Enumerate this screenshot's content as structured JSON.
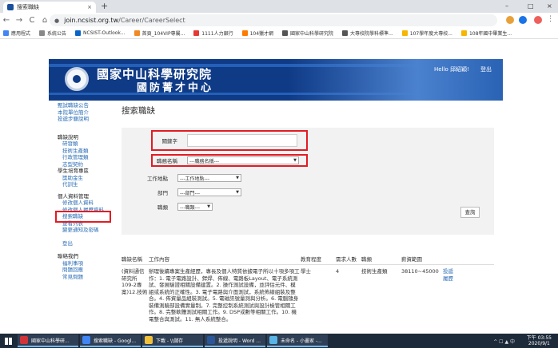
{
  "browser": {
    "tab_title": "搜索職缺",
    "tab_close": "×",
    "new_tab": "+",
    "url_host": "join.ncsist.org.tw",
    "url_path": "/Career/CareerSelect",
    "nav_back": "←",
    "nav_forward": "→",
    "nav_reload": "C",
    "nav_home": "⌂"
  },
  "window_controls": {
    "minimize": "–",
    "maximize": "□",
    "close": "×"
  },
  "bookmarks": [
    {
      "label": "應用程式",
      "color": "#4285f4"
    },
    {
      "label": "系統公告",
      "color": "#888888"
    },
    {
      "label": "NCSIST-Outlook...",
      "color": "#0a64c8"
    },
    {
      "label": "首頁_104VIP專屬...",
      "color": "#f08a24"
    },
    {
      "label": "1111人力銀行",
      "color": "#e53935"
    },
    {
      "label": "104獵才網",
      "color": "#ff7a00"
    },
    {
      "label": "國家中山科學研究院",
      "color": "#555555"
    },
    {
      "label": "大專校院學科標準...",
      "color": "#555555"
    },
    {
      "label": "107學年度大專校...",
      "color": "#f6b500"
    },
    {
      "label": "108年國中畢業生...",
      "color": "#f6b500"
    }
  ],
  "banner": {
    "title": "國家中山科學研究院",
    "subtitle": "國防菁才中心",
    "greeting": "Hello 邱紹穎!",
    "logout": "登出"
  },
  "sidebar": {
    "top_links": [
      "甄試職缺公告",
      "本院單位簡介",
      "投遞步驟說明"
    ],
    "groups": [
      {
        "title": "職缺說明",
        "items": [
          "研發類",
          "技術生產類",
          "行政管理類",
          "志型契約"
        ]
      },
      {
        "title": "學生培育專區",
        "items": [
          "獎助金生",
          "代訓生"
        ]
      },
      {
        "title": "個人資料管理",
        "items": [
          "修改個人資料",
          "修改個人履歷資料",
          "搜索職缺",
          "查看列表",
          "變更通知及密碼"
        ]
      }
    ],
    "logout": "登出",
    "help_title": "聯絡我們",
    "help_items": [
      "福利事項",
      "問題回應",
      "常見問題"
    ]
  },
  "content": {
    "page_title": "搜索職缺",
    "form": {
      "keyword_label": "關鍵字",
      "keyword_value": "",
      "jobname_label": "職務名稱",
      "jobname_value": "---職務名稱---",
      "location_label": "工作地點",
      "location_value": "---工作地點---",
      "dept_label": "部門",
      "dept_value": "---部門---",
      "category_label": "職類",
      "category_value": "---職類---",
      "search_button": "查詢"
    },
    "table": {
      "headers": [
        "職缺名稱",
        "工作內容",
        "教育程度",
        "需求人數",
        "職類",
        "薪資範圍",
        ""
      ],
      "row": {
        "name": "(資料通信研究所109-2專案)12.技術",
        "content": "辦理後續專案生產經歷，專長及個人特質依據電子所以十項多項工作：1. 電子電路設計、銲焊、佈線、電路板Layout、電子系統測試、發展驗證相關設備建置。2. 操作測試設備，並評估元件、模組或系統的正確性。3. 電子電路與介面測試，系統佈線組裝及整合。4. 佈資量品組裝測試。5. 電磁訊號量測與分析。6. 電腦隨身裝備測驗部設備實量制。7. 完整控制系統測試與設計檢管相關工作。8. 完整軟體測試相關工作。9. DSP或數等相關工作。10. 機電整合與測試。11. 無人系統整合。",
        "education": "學士",
        "count": "4",
        "category": "技術生產類",
        "salary": "38110~45000",
        "action1": "投遞",
        "action2": "履歷"
      }
    }
  },
  "taskbar": {
    "items": [
      {
        "label": "國家中山科學研...",
        "color": "#d13438"
      },
      {
        "label": "搜索職缺 - Googl...",
        "color": "#4285f4"
      },
      {
        "label": "下載 - \\\\儲存",
        "color": "#f2c13b"
      },
      {
        "label": "投遞說明 - Word ...",
        "color": "#2b5797"
      },
      {
        "label": "未命名 - 小畫家 -...",
        "color": "#5ab4e6"
      }
    ],
    "time": "下午 03:55",
    "date": "2020/9/1",
    "tray": "^ ☐ ▲ 中"
  }
}
